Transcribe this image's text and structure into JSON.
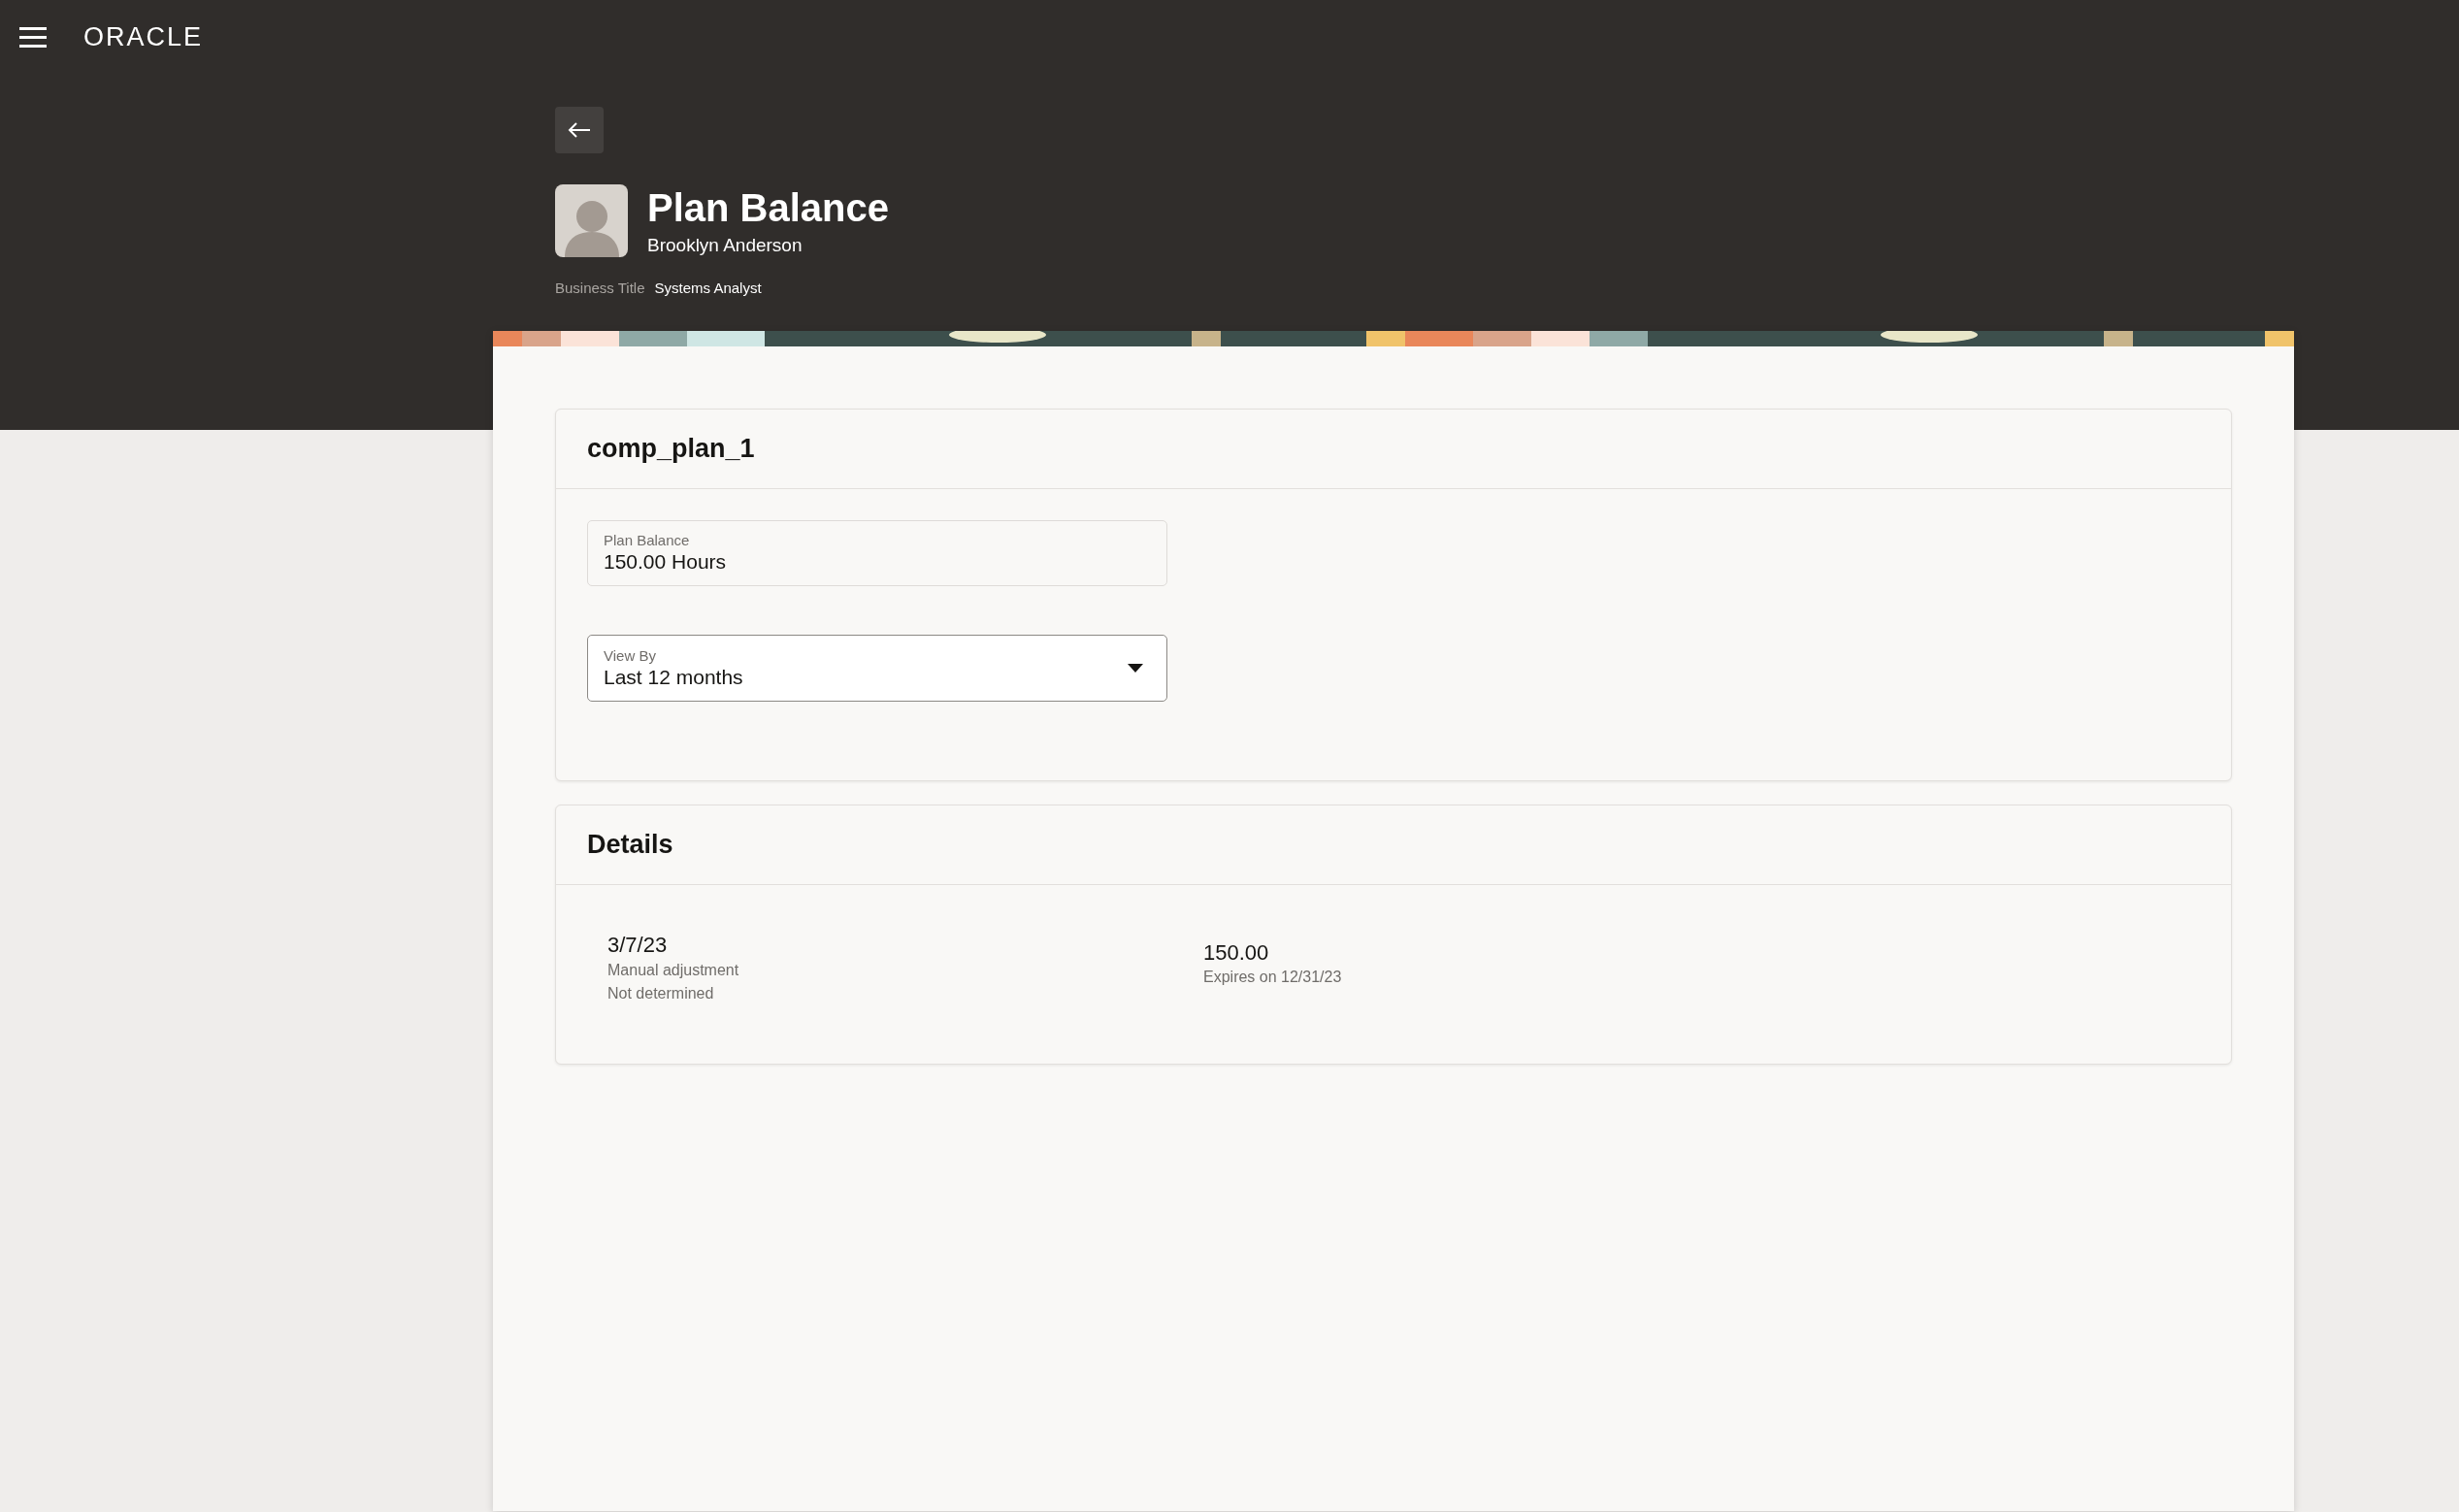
{
  "header": {
    "logo": "ORACLE"
  },
  "page": {
    "title": "Plan Balance",
    "person": "Brooklyn Anderson",
    "business_title": {
      "label": "Business Title",
      "value": "Systems Analyst"
    }
  },
  "plan_card": {
    "title": "comp_plan_1",
    "plan_balance": {
      "label": "Plan Balance",
      "value": "150.00 Hours"
    },
    "view_by": {
      "label": "View By",
      "value": "Last 12 months"
    }
  },
  "details": {
    "title": "Details",
    "rows": [
      {
        "date": "3/7/23",
        "type": "Manual adjustment",
        "status": "Not determined",
        "amount": "150.00",
        "expiry": "Expires on 12/31/23"
      }
    ]
  }
}
